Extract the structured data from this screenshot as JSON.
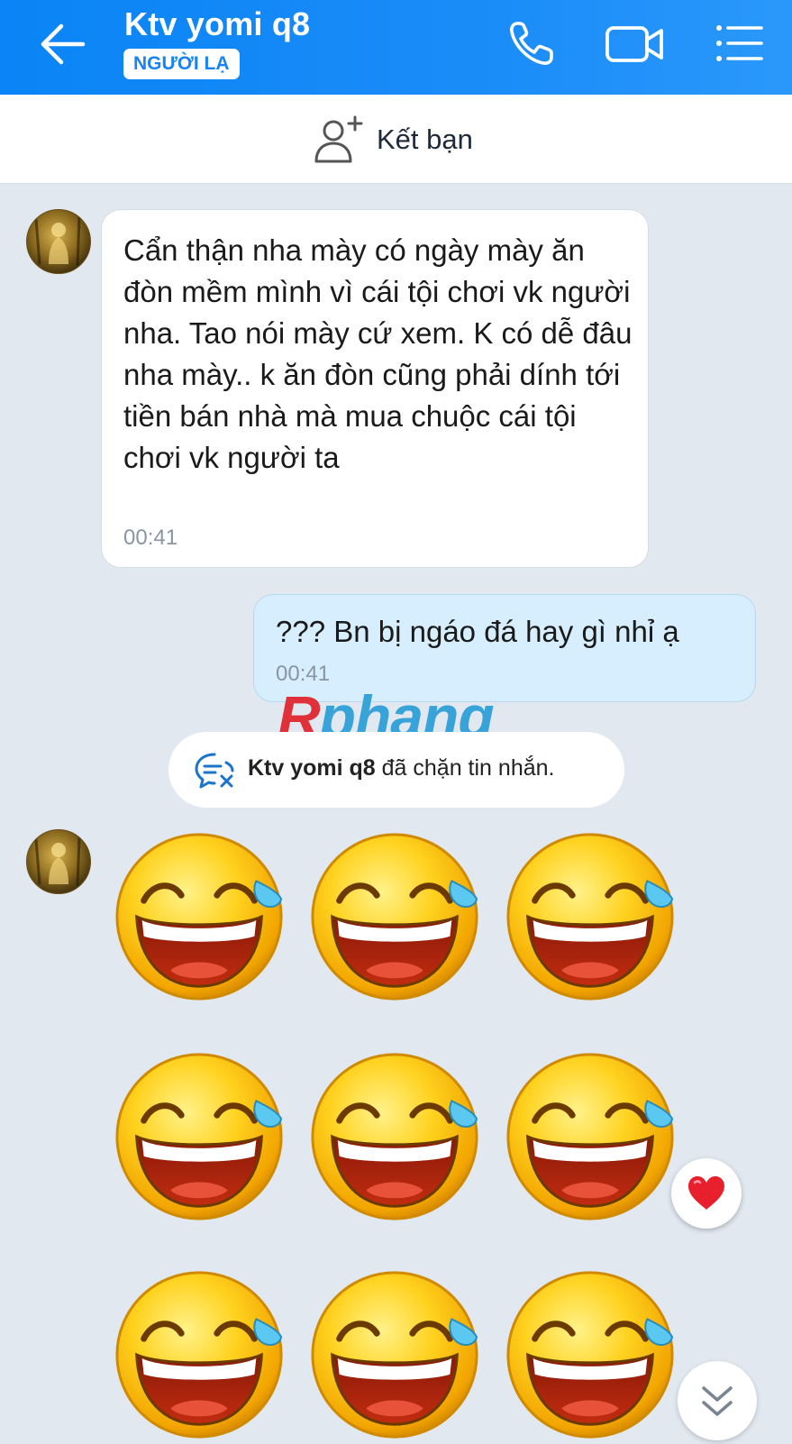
{
  "header": {
    "title": "Ktv yomi q8",
    "badge": "NGƯỜI LẠ",
    "icons": [
      "back-arrow-icon",
      "phone-icon",
      "video-call-icon",
      "menu-list-icon"
    ]
  },
  "friend_bar": {
    "label": "Kết bạn",
    "icon": "add-friend-icon"
  },
  "messages": [
    {
      "direction": "incoming",
      "text": "Cẩn thận nha mày có ngày mày ăn đòn mềm mình vì cái tội chơi vk người nha. Tao nói mày cứ xem. K có dễ đâu nha mày.. k ăn đòn cũng phải dính tới tiền bán nhà mà mua chuộc cái tội chơi vk người ta",
      "time": "00:41"
    },
    {
      "direction": "outgoing",
      "text": "??? Bn bị ngáo đá hay gì nhỉ ạ",
      "time": "00:41"
    }
  ],
  "watermark": {
    "first": "R",
    "rest": "phang"
  },
  "system_notice": {
    "name": "Ktv yomi q8",
    "text": " đã chặn tin nhắn."
  },
  "stickers": {
    "icon": "laughing-tears-emoji",
    "count": 9
  },
  "colors": {
    "header": "#1a8cf8",
    "outgoing_bubble": "#d6eefd",
    "background": "#e1e8f0",
    "heart": "#e8202e"
  }
}
